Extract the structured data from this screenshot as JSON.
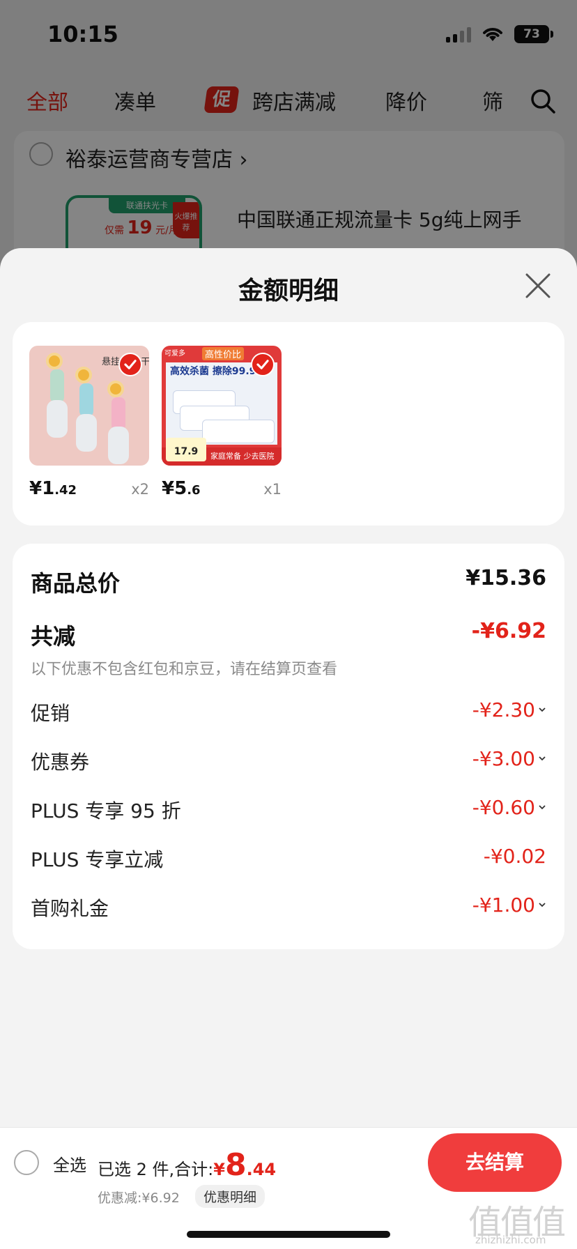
{
  "status_bar": {
    "time": "10:15",
    "battery": "73"
  },
  "top_tabs": [
    {
      "label": "全部",
      "active": true
    },
    {
      "label": "凑单",
      "active": false
    },
    {
      "label": "跨店满减",
      "active": false,
      "badge": "促"
    },
    {
      "label": "降价",
      "active": false
    },
    {
      "label": "筛",
      "active": false
    }
  ],
  "store": {
    "name": "裕泰运营商专营店 ›"
  },
  "background_product": {
    "title": "中国联通正规流量卡 5g纯上网手",
    "card_tag": "联通扶光卡",
    "card_price_prefix": "仅需",
    "card_price": "19",
    "card_price_unit": "元/月",
    "card_hot": "火爆推荐"
  },
  "sheet": {
    "title": "金额明细",
    "items": [
      {
        "price_int": "¥1",
        "price_dec": ".42",
        "qty": "x2",
        "image": "hanging-brush-set",
        "image_text": "悬挂收纳 干"
      },
      {
        "price_int": "¥5",
        "price_dec": ".6",
        "qty": "x1",
        "image": "sterilizing-wipes",
        "image_text": "高效杀菌 擦除99.9%",
        "image_badge": "高性价比",
        "image_brand": "可爱多",
        "image_price": "17.9",
        "image_slogan": "家庭常备 少去医院"
      }
    ],
    "total": {
      "label": "商品总价",
      "value": "¥15.36"
    },
    "reduction": {
      "label": "共减",
      "value": "-¥6.92",
      "note": "以下优惠不包含红包和京豆，请在结算页查看"
    },
    "discounts": [
      {
        "label": "促销",
        "value": "-¥2.30",
        "expandable": true
      },
      {
        "label": "优惠券",
        "value": "-¥3.00",
        "expandable": true
      },
      {
        "label": "PLUS 专享 95 折",
        "value": "-¥0.60",
        "expandable": true
      },
      {
        "label": "PLUS 专享立减",
        "value": "-¥0.02",
        "expandable": false
      },
      {
        "label": "首购礼金",
        "value": "-¥1.00",
        "expandable": true
      }
    ]
  },
  "footer": {
    "select_all": "全选",
    "summary_prefix": "已选 2 件,合计:",
    "currency": "¥",
    "total_int": "8",
    "total_dec": ".44",
    "discount_text": "优惠减:¥6.92",
    "detail_label": "优惠明细",
    "checkout_label": "去结算"
  },
  "watermark": {
    "text": "值值值",
    "url": "zhizhizhi.com"
  },
  "colors": {
    "accent": "#e2231a",
    "checkout": "#f03d3d",
    "sheet_bg": "#f3f3f3"
  }
}
